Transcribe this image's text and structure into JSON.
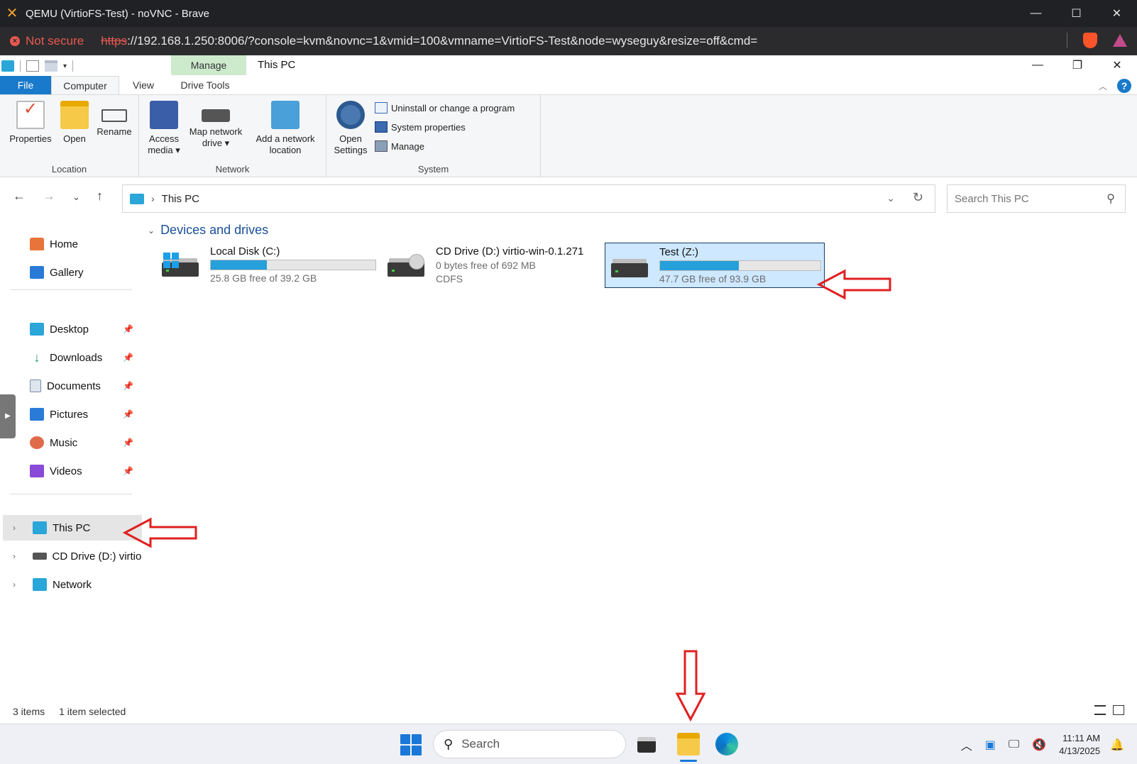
{
  "browser": {
    "title": "QEMU (VirtioFS-Test) - noVNC - Brave",
    "not_secure": "Not secure",
    "url_scheme": "https",
    "url_rest": "://192.168.1.250:8006/?console=kvm&novnc=1&vmid=100&vmname=VirtioFS-Test&node=wyseguy&resize=off&cmd="
  },
  "explorer": {
    "window_title": "This PC",
    "manage_tab": "Manage",
    "tabs": [
      "File",
      "Computer",
      "View",
      "Drive Tools"
    ],
    "ribbon": {
      "location": {
        "label": "Location",
        "properties": "Properties",
        "open": "Open",
        "rename": "Rename"
      },
      "network": {
        "label": "Network",
        "access_media_1": "Access",
        "access_media_2": "media ▾",
        "map_drive_1": "Map network",
        "map_drive_2": "drive ▾",
        "add_loc_1": "Add a network",
        "add_loc_2": "location"
      },
      "system": {
        "label": "System",
        "open_settings_1": "Open",
        "open_settings_2": "Settings",
        "uninstall": "Uninstall or change a program",
        "system_properties": "System properties",
        "manage": "Manage"
      }
    },
    "address": {
      "crumb": "This PC",
      "search_placeholder": "Search This PC"
    },
    "sidebar": {
      "home": "Home",
      "gallery": "Gallery",
      "quick": [
        {
          "label": "Desktop",
          "color": "#2aa6d8"
        },
        {
          "label": "Downloads",
          "color": "#1a9a6a"
        },
        {
          "label": "Documents",
          "color": "#7a8ca8"
        },
        {
          "label": "Pictures",
          "color": "#2a7ad8"
        },
        {
          "label": "Music",
          "color": "#e06a4a"
        },
        {
          "label": "Videos",
          "color": "#8a4ad8"
        }
      ],
      "this_pc": "This PC",
      "cd_drive": "CD Drive (D:) virtio-",
      "network": "Network"
    },
    "content": {
      "section": "Devices and drives",
      "drives": [
        {
          "name": "Local Disk (C:)",
          "info": "25.8 GB free of 39.2 GB",
          "used_fraction": 0.34
        },
        {
          "name": "CD Drive (D:) virtio-win-0.1.271",
          "info": "0 bytes free of 692 MB",
          "fs": "CDFS"
        },
        {
          "name": "Test (Z:)",
          "info": "47.7 GB free of 93.9 GB",
          "used_fraction": 0.49
        }
      ]
    },
    "status": {
      "items": "3 items",
      "selected": "1 item selected"
    }
  },
  "taskbar": {
    "search": "Search",
    "time": "11:11 AM",
    "date": "4/13/2025"
  },
  "colors": {
    "accent": "#1979ca",
    "annotation": "#e02020",
    "selection": "#cde8ff"
  }
}
